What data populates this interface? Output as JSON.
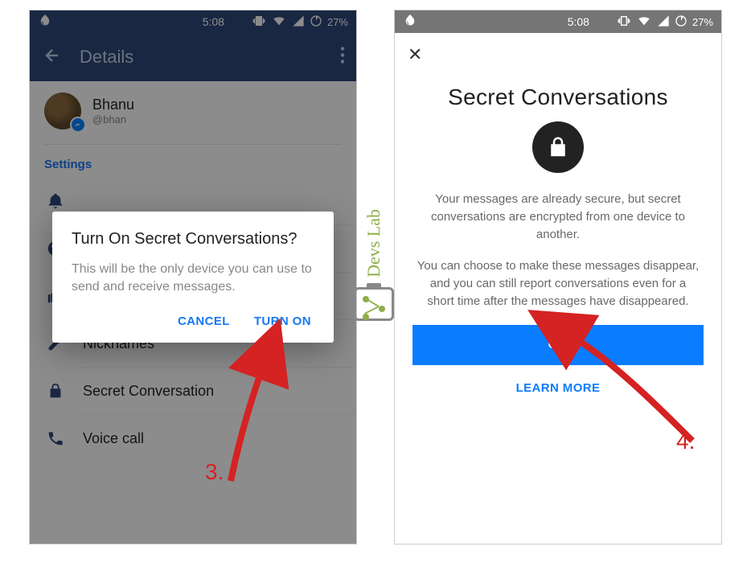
{
  "statusbar": {
    "time": "5:08",
    "battery_pct": "27%"
  },
  "left": {
    "appbar": {
      "title": "Details"
    },
    "profile": {
      "name": "Bhanu",
      "handle": "@bhan"
    },
    "sections": {
      "settings_label": "Settings"
    },
    "rows": {
      "nicknames": "Nicknames",
      "secret": "Secret Conversation",
      "voice": "Voice call"
    },
    "dialog": {
      "title": "Turn On Secret Conversations?",
      "body": "This will be the only device you can use to send and receive messages.",
      "cancel": "CANCEL",
      "confirm": "TURN ON"
    }
  },
  "right": {
    "title": "Secret Conversations",
    "para1": "Your messages are already secure, but secret conversations are encrypted from one device to another.",
    "para2": "You can choose to make these messages disappear, and you can still report conversations even for a short time after the messages have disappeared.",
    "ok": "OK",
    "learn_more": "LEARN MORE"
  },
  "annotations": {
    "step3": "3.",
    "step4": "4."
  },
  "watermark": {
    "text": "Devs Lab"
  }
}
